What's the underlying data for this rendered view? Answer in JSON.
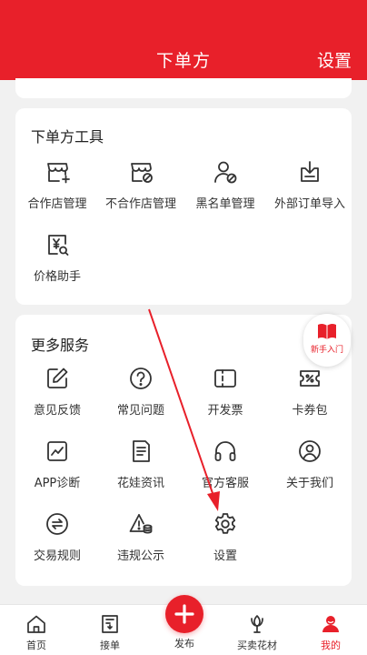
{
  "header": {
    "title": "下单方",
    "settings_label": "设置"
  },
  "tools": {
    "title": "下单方工具",
    "items": [
      {
        "label": "合作店管理",
        "icon": "store-add-icon"
      },
      {
        "label": "不合作店管理",
        "icon": "store-blocked-icon"
      },
      {
        "label": "黑名单管理",
        "icon": "user-blocked-icon"
      },
      {
        "label": "外部订单导入",
        "icon": "import-icon"
      },
      {
        "label": "价格助手",
        "icon": "price-search-icon"
      }
    ]
  },
  "more": {
    "title": "更多服务",
    "items": [
      {
        "label": "意见反馈",
        "icon": "edit-icon"
      },
      {
        "label": "常见问题",
        "icon": "question-icon"
      },
      {
        "label": "开发票",
        "icon": "invoice-icon"
      },
      {
        "label": "卡券包",
        "icon": "coupon-icon"
      },
      {
        "label": "APP诊断",
        "icon": "diagnosis-icon"
      },
      {
        "label": "花娃资讯",
        "icon": "news-icon"
      },
      {
        "label": "官方客服",
        "icon": "headset-icon"
      },
      {
        "label": "关于我们",
        "icon": "about-icon"
      },
      {
        "label": "交易规则",
        "icon": "exchange-icon"
      },
      {
        "label": "违规公示",
        "icon": "warning-icon"
      },
      {
        "label": "设置",
        "icon": "gear-icon"
      }
    ]
  },
  "floating": {
    "label": "新手入门"
  },
  "tabbar": {
    "items": [
      {
        "label": "首页",
        "icon": "home-icon"
      },
      {
        "label": "接单",
        "icon": "order-icon"
      },
      {
        "label": "发布",
        "icon": "plus-icon"
      },
      {
        "label": "买卖花材",
        "icon": "flower-icon"
      },
      {
        "label": "我的",
        "icon": "profile-icon"
      }
    ],
    "active": "我的"
  },
  "colors": {
    "brand": "#e8202a",
    "background": "#f1f1f1"
  }
}
